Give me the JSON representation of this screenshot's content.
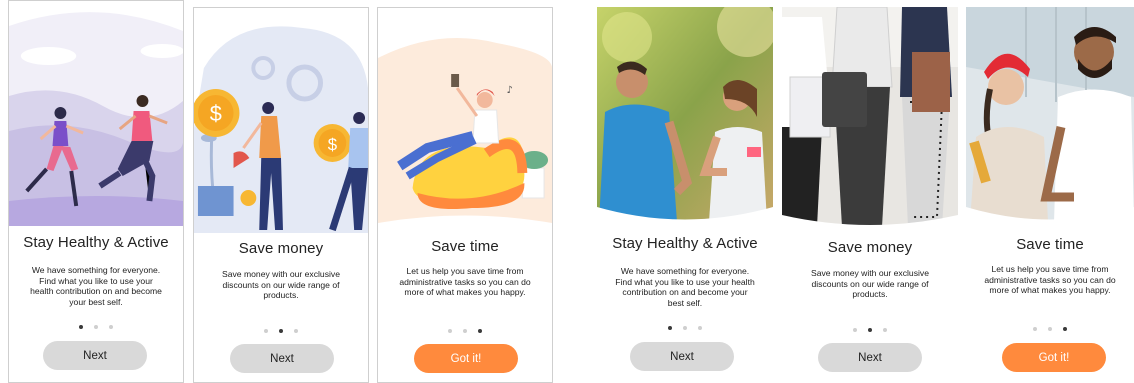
{
  "screens": [
    {
      "title": "Stay Healthy & Active",
      "description": "We have something for everyone. Find what you like to use your health contribution on and become your best self.",
      "button": "Next"
    },
    {
      "title": "Save money",
      "description": "Save money with our exclusive discounts on our wide range of products.",
      "button": "Next"
    },
    {
      "title": "Save time",
      "description": "Let us help you save time from administrative tasks so you can do more of what makes you happy.",
      "button": "Got it!"
    },
    {
      "title": "Stay Healthy & Active",
      "description": "We have something for everyone. Find what you like to use your health contribution on and become your best self.",
      "button": "Next"
    },
    {
      "title": "Save money",
      "description": "Save money with our exclusive discounts on our wide range of products.",
      "button": "Next"
    },
    {
      "title": "Save time",
      "description": "Let us help you save time from administrative tasks so you can do more of what makes you happy.",
      "button": "Got it!"
    }
  ],
  "colors": {
    "accent": "#ff8a3d",
    "button_grey": "#d9d9d9",
    "dot_active": "#3a3a3a",
    "dot_inactive": "#cfcfcf",
    "coin": "#f7b733",
    "illustration_purple": "#b7a8e0"
  }
}
